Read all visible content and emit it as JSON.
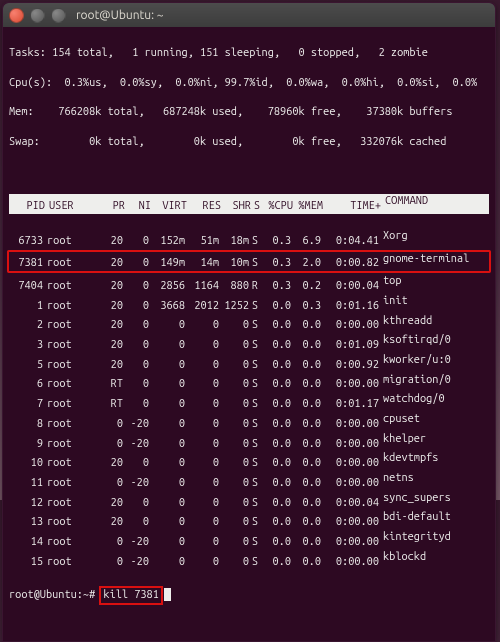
{
  "titlebar": {
    "title": "root@Ubuntu: ~"
  },
  "summary": {
    "line1": "Tasks: 154 total,   1 running, 151 sleeping,   0 stopped,   2 zombie",
    "line2": "Cpu(s):  0.3%us,  0.0%sy,  0.0%ni, 99.7%id,  0.0%wa,  0.0%hi,  0.0%si,  0.0%",
    "line3": "Mem:    766208k total,   687248k used,    78960k free,    37380k buffers",
    "line4": "Swap:        0k total,        0k used,        0k free,   332076k cached"
  },
  "columns": [
    "PID",
    "USER",
    "PR",
    "NI",
    "VIRT",
    "RES",
    "SHR",
    "S",
    "%CPU",
    "%MEM",
    "TIME+",
    "COMMAND"
  ],
  "rows": [
    {
      "pid": "6733",
      "user": "root",
      "pr": "20",
      "ni": "0",
      "virt": "152m",
      "res": "51m",
      "shr": "18m",
      "s": "S",
      "cpu": "0.3",
      "mem": "6.9",
      "time": "0:04.41",
      "cmd": "Xorg",
      "hl": false
    },
    {
      "pid": "7381",
      "user": "root",
      "pr": "20",
      "ni": "0",
      "virt": "149m",
      "res": "14m",
      "shr": "10m",
      "s": "S",
      "cpu": "0.3",
      "mem": "2.0",
      "time": "0:00.82",
      "cmd": "gnome-terminal",
      "hl": true
    },
    {
      "pid": "7404",
      "user": "root",
      "pr": "20",
      "ni": "0",
      "virt": "2856",
      "res": "1164",
      "shr": "880",
      "s": "R",
      "cpu": "0.3",
      "mem": "0.2",
      "time": "0:00.04",
      "cmd": "top",
      "hl": false
    },
    {
      "pid": "1",
      "user": "root",
      "pr": "20",
      "ni": "0",
      "virt": "3668",
      "res": "2012",
      "shr": "1252",
      "s": "S",
      "cpu": "0.0",
      "mem": "0.3",
      "time": "0:01.16",
      "cmd": "init",
      "hl": false
    },
    {
      "pid": "2",
      "user": "root",
      "pr": "20",
      "ni": "0",
      "virt": "0",
      "res": "0",
      "shr": "0",
      "s": "S",
      "cpu": "0.0",
      "mem": "0.0",
      "time": "0:00.00",
      "cmd": "kthreadd",
      "hl": false
    },
    {
      "pid": "3",
      "user": "root",
      "pr": "20",
      "ni": "0",
      "virt": "0",
      "res": "0",
      "shr": "0",
      "s": "S",
      "cpu": "0.0",
      "mem": "0.0",
      "time": "0:01.09",
      "cmd": "ksoftirqd/0",
      "hl": false
    },
    {
      "pid": "5",
      "user": "root",
      "pr": "20",
      "ni": "0",
      "virt": "0",
      "res": "0",
      "shr": "0",
      "s": "S",
      "cpu": "0.0",
      "mem": "0.0",
      "time": "0:00.92",
      "cmd": "kworker/u:0",
      "hl": false
    },
    {
      "pid": "6",
      "user": "root",
      "pr": "RT",
      "ni": "0",
      "virt": "0",
      "res": "0",
      "shr": "0",
      "s": "S",
      "cpu": "0.0",
      "mem": "0.0",
      "time": "0:00.00",
      "cmd": "migration/0",
      "hl": false
    },
    {
      "pid": "7",
      "user": "root",
      "pr": "RT",
      "ni": "0",
      "virt": "0",
      "res": "0",
      "shr": "0",
      "s": "S",
      "cpu": "0.0",
      "mem": "0.0",
      "time": "0:01.17",
      "cmd": "watchdog/0",
      "hl": false
    },
    {
      "pid": "8",
      "user": "root",
      "pr": "0",
      "ni": "-20",
      "virt": "0",
      "res": "0",
      "shr": "0",
      "s": "S",
      "cpu": "0.0",
      "mem": "0.0",
      "time": "0:00.00",
      "cmd": "cpuset",
      "hl": false
    },
    {
      "pid": "9",
      "user": "root",
      "pr": "0",
      "ni": "-20",
      "virt": "0",
      "res": "0",
      "shr": "0",
      "s": "S",
      "cpu": "0.0",
      "mem": "0.0",
      "time": "0:00.00",
      "cmd": "khelper",
      "hl": false
    },
    {
      "pid": "10",
      "user": "root",
      "pr": "20",
      "ni": "0",
      "virt": "0",
      "res": "0",
      "shr": "0",
      "s": "S",
      "cpu": "0.0",
      "mem": "0.0",
      "time": "0:00.00",
      "cmd": "kdevtmpfs",
      "hl": false
    },
    {
      "pid": "11",
      "user": "root",
      "pr": "0",
      "ni": "-20",
      "virt": "0",
      "res": "0",
      "shr": "0",
      "s": "S",
      "cpu": "0.0",
      "mem": "0.0",
      "time": "0:00.00",
      "cmd": "netns",
      "hl": false
    },
    {
      "pid": "12",
      "user": "root",
      "pr": "20",
      "ni": "0",
      "virt": "0",
      "res": "0",
      "shr": "0",
      "s": "S",
      "cpu": "0.0",
      "mem": "0.0",
      "time": "0:00.04",
      "cmd": "sync_supers",
      "hl": false
    },
    {
      "pid": "13",
      "user": "root",
      "pr": "20",
      "ni": "0",
      "virt": "0",
      "res": "0",
      "shr": "0",
      "s": "S",
      "cpu": "0.0",
      "mem": "0.0",
      "time": "0:00.00",
      "cmd": "bdi-default",
      "hl": false
    },
    {
      "pid": "14",
      "user": "root",
      "pr": "0",
      "ni": "-20",
      "virt": "0",
      "res": "0",
      "shr": "0",
      "s": "S",
      "cpu": "0.0",
      "mem": "0.0",
      "time": "0:00.00",
      "cmd": "kintegrityd",
      "hl": false
    },
    {
      "pid": "15",
      "user": "root",
      "pr": "0",
      "ni": "-20",
      "virt": "0",
      "res": "0",
      "shr": "0",
      "s": "S",
      "cpu": "0.0",
      "mem": "0.0",
      "time": "0:00.00",
      "cmd": "kblockd",
      "hl": false
    }
  ],
  "prompt": {
    "user_host": "root@Ubuntu",
    "path": ":~#",
    "command": "kill 7381"
  }
}
